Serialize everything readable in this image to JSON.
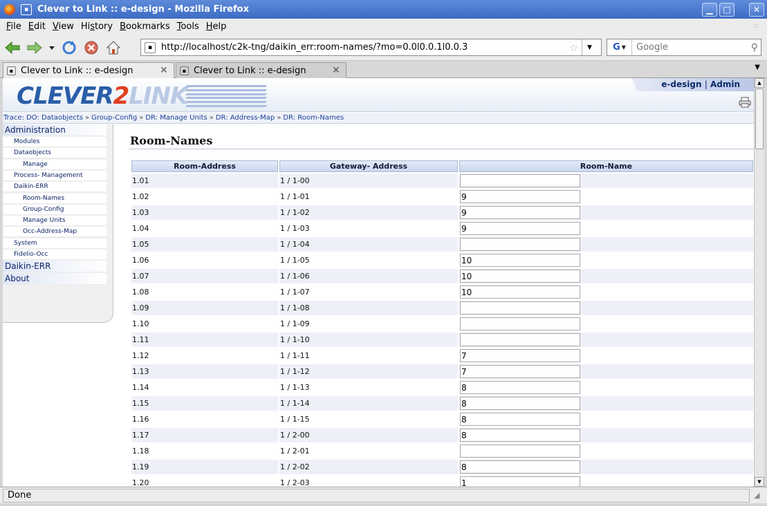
{
  "window": {
    "title": "Clever to Link :: e-design - Mozilla Firefox"
  },
  "menu": {
    "items": [
      {
        "label": "File",
        "key": "F"
      },
      {
        "label": "Edit",
        "key": "E"
      },
      {
        "label": "View",
        "key": "V"
      },
      {
        "label": "History",
        "key": "s"
      },
      {
        "label": "Bookmarks",
        "key": "B"
      },
      {
        "label": "Tools",
        "key": "T"
      },
      {
        "label": "Help",
        "key": "H"
      }
    ]
  },
  "navbar": {
    "url": "http://localhost/c2k-tng/daikin_err:room-names/?mo=0.0l0.0.1l0.0.3",
    "search_placeholder": "Google",
    "search_engine": "G"
  },
  "tabs": [
    {
      "label": "Clever to Link :: e-design",
      "active": true
    },
    {
      "label": "Clever to Link :: e-design",
      "active": false
    }
  ],
  "header": {
    "logo_part1": "CLEVER",
    "logo_part2": "2",
    "logo_part3": "LINK",
    "user_company": "e-design",
    "user_sep": "|",
    "user_role": "Admin"
  },
  "trace": {
    "prefix": "Trace:",
    "crumbs": [
      "DO: Dataobjects",
      "Group-Config",
      "DR: Manage Units",
      "DR: Address-Map",
      "DR: Room-Names"
    ]
  },
  "sidebar": {
    "items": [
      {
        "label": "Administration",
        "level": 0
      },
      {
        "label": "Modules",
        "level": 1
      },
      {
        "label": "Dataobjects",
        "level": 1
      },
      {
        "label": "Manage",
        "level": 2
      },
      {
        "label": "Process- Management",
        "level": 1
      },
      {
        "label": "Daikin-ERR",
        "level": 1
      },
      {
        "label": "Room-Names",
        "level": 2
      },
      {
        "label": "Group-Config",
        "level": 2
      },
      {
        "label": "Manage Units",
        "level": 2
      },
      {
        "label": "Occ-Address-Map",
        "level": 2
      },
      {
        "label": "System",
        "level": 1
      },
      {
        "label": "Fidelio-Occ",
        "level": 1
      },
      {
        "label": "Daikin-ERR",
        "level": 0
      },
      {
        "label": "About",
        "level": 0
      }
    ]
  },
  "main": {
    "title": "Room-Names",
    "columns": [
      "Room-Address",
      "Gateway- Address",
      "Room-Name"
    ],
    "rows": [
      {
        "room": "1.01",
        "gateway": "1 / 1-00",
        "name": ""
      },
      {
        "room": "1.02",
        "gateway": "1 / 1-01",
        "name": "9"
      },
      {
        "room": "1.03",
        "gateway": "1 / 1-02",
        "name": "9"
      },
      {
        "room": "1.04",
        "gateway": "1 / 1-03",
        "name": "9"
      },
      {
        "room": "1.05",
        "gateway": "1 / 1-04",
        "name": ""
      },
      {
        "room": "1.06",
        "gateway": "1 / 1-05",
        "name": "10"
      },
      {
        "room": "1.07",
        "gateway": "1 / 1-06",
        "name": "10"
      },
      {
        "room": "1.08",
        "gateway": "1 / 1-07",
        "name": "10"
      },
      {
        "room": "1.09",
        "gateway": "1 / 1-08",
        "name": ""
      },
      {
        "room": "1.10",
        "gateway": "1 / 1-09",
        "name": ""
      },
      {
        "room": "1.11",
        "gateway": "1 / 1-10",
        "name": ""
      },
      {
        "room": "1.12",
        "gateway": "1 / 1-11",
        "name": "7"
      },
      {
        "room": "1.13",
        "gateway": "1 / 1-12",
        "name": "7"
      },
      {
        "room": "1.14",
        "gateway": "1 / 1-13",
        "name": "8"
      },
      {
        "room": "1.15",
        "gateway": "1 / 1-14",
        "name": "8"
      },
      {
        "room": "1.16",
        "gateway": "1 / 1-15",
        "name": "8"
      },
      {
        "room": "1.17",
        "gateway": "1 / 2-00",
        "name": "8"
      },
      {
        "room": "1.18",
        "gateway": "1 / 2-01",
        "name": ""
      },
      {
        "room": "1.19",
        "gateway": "1 / 2-02",
        "name": "8"
      },
      {
        "room": "1.20",
        "gateway": "1 / 2-03",
        "name": "1"
      }
    ]
  },
  "status": {
    "text": "Done"
  },
  "colors": {
    "titlebar": "#3d6cc4",
    "logo_blue": "#2a5ea8",
    "logo_red": "#e0401f",
    "link_blue": "#1b3f99"
  }
}
